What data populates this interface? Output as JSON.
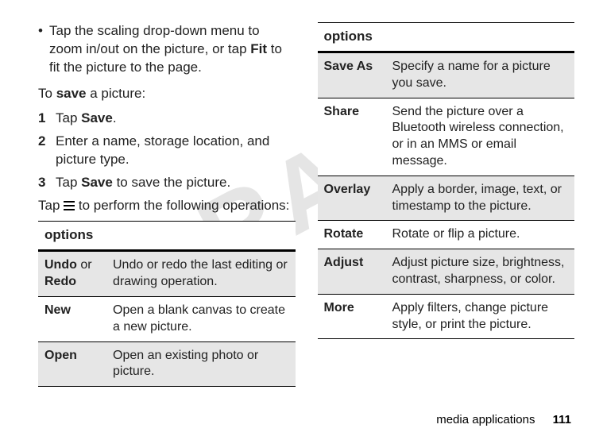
{
  "watermark": "DRAFT",
  "left": {
    "bullet_prefix": "Tap the scaling drop-down menu to zoom in/out on the picture, or tap ",
    "bullet_fit": "Fit",
    "bullet_suffix": " to fit the picture to the page.",
    "save_intro_pre": "To ",
    "save_intro_bold": "save",
    "save_intro_post": " a picture:",
    "step1_num": "1",
    "step1_pre": "Tap ",
    "step1_bold": "Save",
    "step1_post": ".",
    "step2_num": "2",
    "step2_text": "Enter a name, storage location, and picture type.",
    "step3_num": "3",
    "step3_pre": "Tap ",
    "step3_bold": "Save",
    "step3_post": " to save the picture.",
    "tap_menu_pre": "Tap ",
    "tap_menu_post": " to perform the following operations:",
    "options_header": "options",
    "rows": [
      {
        "key_a": "Undo",
        "key_mid": " or ",
        "key_b": "Redo",
        "desc": "Undo or redo the last editing or drawing operation."
      },
      {
        "key_a": "New",
        "desc": "Open a blank canvas to create a new picture."
      },
      {
        "key_a": "Open",
        "desc": "Open an existing photo or picture."
      }
    ]
  },
  "right": {
    "options_header": "options",
    "rows": [
      {
        "key": "Save As",
        "desc": "Specify a name for a picture you save."
      },
      {
        "key": "Share",
        "desc": "Send the picture over a Bluetooth wireless connection, or in an MMS or email message."
      },
      {
        "key": "Overlay",
        "desc": "Apply a border, image, text, or timestamp to the picture."
      },
      {
        "key": "Rotate",
        "desc": "Rotate or flip a picture."
      },
      {
        "key": "Adjust",
        "desc": "Adjust picture size, brightness, contrast, sharpness, or color."
      },
      {
        "key": "More",
        "desc": "Apply filters, change picture style, or print the picture."
      }
    ]
  },
  "footer": {
    "section": "media applications",
    "page": "111"
  }
}
